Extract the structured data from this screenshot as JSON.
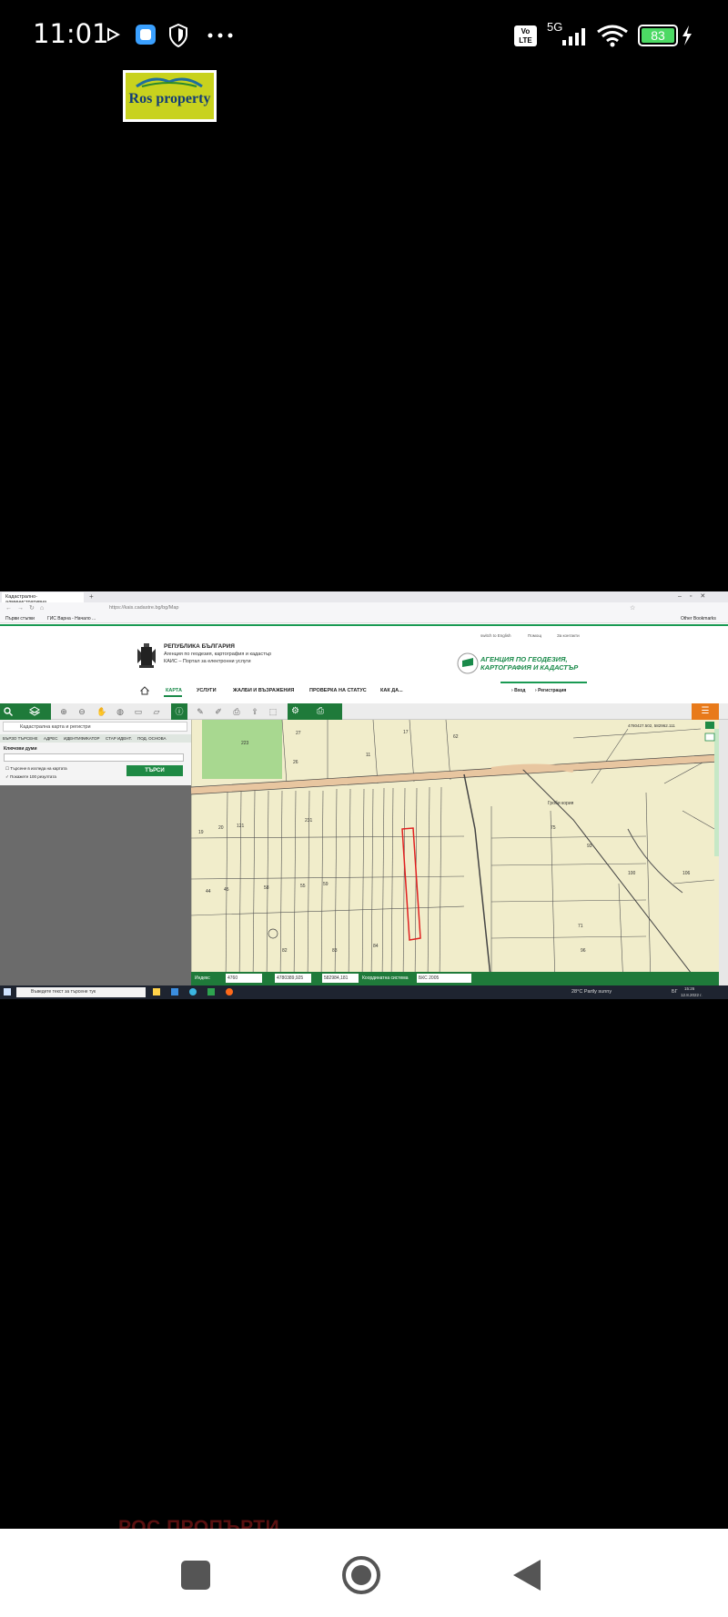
{
  "status": {
    "time": "11:01",
    "network_volte": "Vo LTE",
    "network_5g": "5G",
    "battery": "83"
  },
  "logo": {
    "text": "Ros property"
  },
  "browser": {
    "tab_title": "Кадастрално-административна...",
    "url": "https://kais.cadastre.bg/bg/Map",
    "bookmark_1": "Първи стъпки",
    "bookmark_2": "ГИС Варна - Начало ...",
    "other_bookmarks": "Other Bookmarks"
  },
  "site": {
    "republic": "РЕПУБЛИКА БЪЛГАРИЯ",
    "agency_line": "Агенция по геодезия, картография и кадастър",
    "portal_line": "КАИС – Портал за електронни услуги",
    "agency_logo_1": "АГЕНЦИЯ ПО ГЕОДЕЗИЯ,",
    "agency_logo_2": "КАРТОГРАФИЯ И КАДАСТЪР",
    "switch_english": "switch to English",
    "help": "Помощ",
    "feedback": "За контакти",
    "login": "Вход",
    "register": "Регистрация",
    "nav": [
      "КАРТА",
      "УСЛУГИ",
      "ЖАЛБИ И ВЪЗРАЖЕНИЯ",
      "ПРОВЕРКА НА СТАТУС",
      "КАК ДА..."
    ]
  },
  "left_panel": {
    "layer_select": "Кадастрална карта и регистри",
    "tabs": [
      "БЪРЗО ТЪРСЕНЕ",
      "АДРЕС",
      "ИДЕНТИФИКАТОР",
      "СТАР ИДЕНТ.",
      "ПОД. ОСНОВА"
    ],
    "field_label": "Ключови думи",
    "option_1": "Търсене в изгледа на картата",
    "option_2": "Покажете 100 резултата",
    "search_button": "ТЪРСИ"
  },
  "map": {
    "coords_top": "4780427.502, 582962.111",
    "parcel_labels": [
      "223",
      "27",
      "26",
      "17",
      "11",
      "62",
      "231",
      "19",
      "20",
      "121",
      "44",
      "45",
      "58",
      "55",
      "59",
      "84",
      "82",
      "83",
      "75",
      "71",
      "96",
      "100",
      "106",
      "93"
    ],
    "road_label": "Гроби кория"
  },
  "coord_bar": {
    "label_1": "Индекс",
    "value_1": "4760",
    "value_2": "4780389,925",
    "value_3": "582984,181",
    "system_label": "Координатна система",
    "system_value": "БКС 2005"
  },
  "taskbar": {
    "search_placeholder": "Въведете текст за търсене тук",
    "weather": "28°C  Partly sunny",
    "lang": "БГ",
    "time": "15:26",
    "date": "12.8.2022 г."
  },
  "overlay_text": "РОС ПРОПЪРТИ"
}
